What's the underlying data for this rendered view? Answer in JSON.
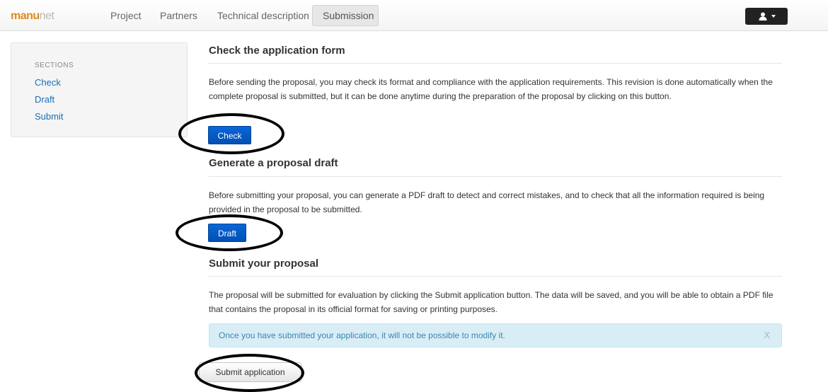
{
  "brand": {
    "part1": "manu",
    "part2": "net"
  },
  "nav": {
    "items": [
      {
        "label": "Project"
      },
      {
        "label": "Partners"
      },
      {
        "label": "Technical description"
      },
      {
        "label": "Submission"
      }
    ],
    "active": "Submission",
    "user_icon": "user-icon"
  },
  "sidebar": {
    "heading": "SECTIONS",
    "links": [
      "Check",
      "Draft",
      "Submit"
    ]
  },
  "check": {
    "title": "Check the application form",
    "text": "Before sending the proposal, you may check its format and compliance with the application requirements. This revision is done automatically when the complete proposal is submitted, but it can be done anytime during the preparation of the proposal by clicking on this button.",
    "button": "Check"
  },
  "draft": {
    "title": "Generate a proposal draft",
    "text": "Before submitting your proposal, you can generate a PDF draft to detect and correct mistakes, and to check that all the information required is being provided in the proposal to be submitted.",
    "button": "Draft"
  },
  "submit": {
    "title": "Submit your proposal",
    "text": "The proposal will be submitted for evaluation by clicking the Submit application button. The data will be saved, and you will be able to obtain a PDF file that contains the proposal in its official format for saving or printing purposes.",
    "alert": "Once you have submitted your application, it will not be possible to modify it.",
    "alert_close": "X",
    "button": "Submit application"
  },
  "colors": {
    "brand_orange": "#e08a1b",
    "link_blue": "#1a6fb5",
    "primary_button": "#0a5fcc",
    "alert_bg": "#d9edf7",
    "alert_text": "#3a87ad"
  }
}
